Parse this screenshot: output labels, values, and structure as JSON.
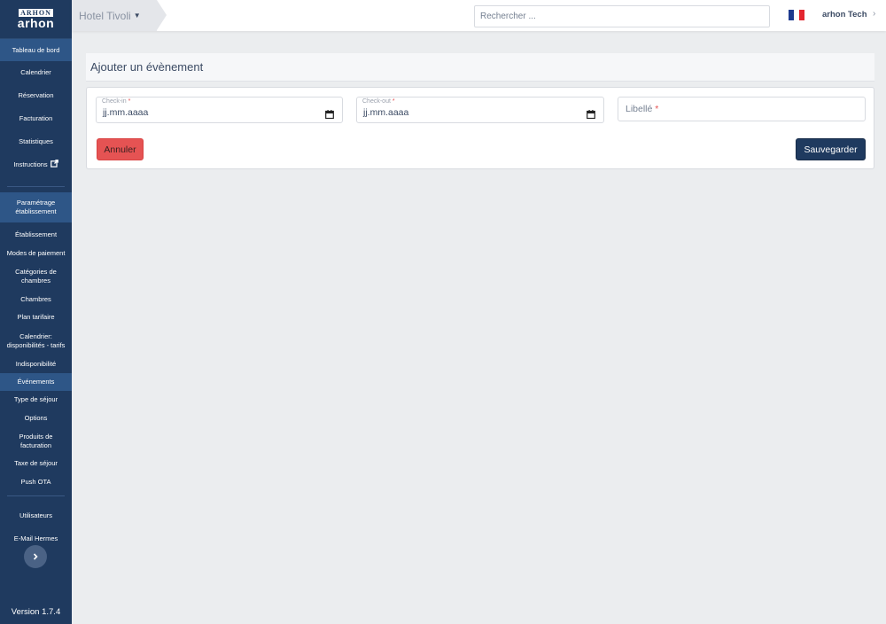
{
  "brand": {
    "mark": "ARHON",
    "word": "arhon"
  },
  "sidebar": {
    "items": [
      {
        "label": "Tableau de bord"
      },
      {
        "label": "Calendrier"
      },
      {
        "label": "Réservation"
      },
      {
        "label": "Facturation"
      },
      {
        "label": "Statistiques"
      },
      {
        "label": "Instructions"
      }
    ],
    "section_label": "Paramétrage établissement",
    "sub_items": [
      {
        "label": "Établissement"
      },
      {
        "label": "Modes de paiement"
      },
      {
        "label": "Catégories de chambres"
      },
      {
        "label": "Chambres"
      },
      {
        "label": "Plan tarifaire"
      },
      {
        "label": "Calendrier: disponibilités - tarifs"
      },
      {
        "label": "Indisponibilité"
      },
      {
        "label": "Événements"
      },
      {
        "label": "Type de séjour"
      },
      {
        "label": "Options"
      },
      {
        "label": "Produits de facturation"
      },
      {
        "label": "Taxe de séjour"
      },
      {
        "label": "Push OTA"
      }
    ],
    "bottom_items": [
      {
        "label": "Utilisateurs"
      },
      {
        "label": "E-Mail Hermes"
      }
    ],
    "active": "Événements",
    "version": "Version 1.7.4"
  },
  "header": {
    "hotel": "Hotel Tivoli",
    "search_placeholder": "Rechercher ...",
    "language": "fr",
    "user": "arhon Tech"
  },
  "page": {
    "title": "Ajouter un évènement",
    "checkin_label": "Check-in",
    "checkin_value": "jj.mm.aaaa",
    "checkout_label": "Check-out",
    "checkout_value": "jj.mm.aaaa",
    "libelle_label": "Libellé",
    "required_mark": "*",
    "cancel": "Annuler",
    "save": "Sauvegarder"
  },
  "colors": {
    "sidebar": "#1f3a5f",
    "active_item": "#2e5687",
    "danger": "#e55353",
    "primary": "#1f3a5f"
  },
  "icons": [
    "external-link-icon",
    "caret-down-icon",
    "calendar-icon",
    "chevron-right-icon",
    "france-flag-icon"
  ]
}
